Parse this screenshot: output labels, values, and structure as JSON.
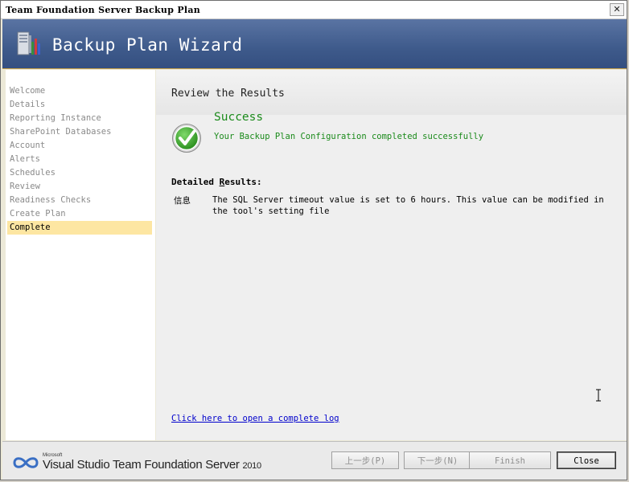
{
  "window": {
    "title": "Team Foundation Server Backup Plan",
    "close_glyph": "✕"
  },
  "banner": {
    "title": "Backup Plan Wizard",
    "icon": "server-icon"
  },
  "nav": {
    "items": [
      {
        "label": "Welcome"
      },
      {
        "label": "Details"
      },
      {
        "label": "Reporting Instance"
      },
      {
        "label": "SharePoint Databases"
      },
      {
        "label": "Account"
      },
      {
        "label": "Alerts"
      },
      {
        "label": "Schedules"
      },
      {
        "label": "Review"
      },
      {
        "label": "Readiness Checks"
      },
      {
        "label": "Create Plan"
      },
      {
        "label": "Complete"
      }
    ],
    "active_index": 10
  },
  "main": {
    "title": "Review the Results",
    "status_title": "Success",
    "status_message": "Your Backup Plan Configuration completed successfully",
    "status_icon": "checkmark-icon",
    "details_heading_prefix": "Detailed ",
    "details_heading_mnemonic": "R",
    "details_heading_suffix": "esults:",
    "details": [
      {
        "type": "信息",
        "message": "The SQL Server timeout value is set to 6 hours. This value can be modified in the tool's setting file"
      }
    ],
    "log_link": "Click here to open a complete log"
  },
  "footer": {
    "brand_ms": "Microsoft",
    "brand": "Visual Studio Team Foundation Server",
    "brand_year": "2010",
    "buttons": {
      "previous": "上一步(P)",
      "next": "下一步(N)",
      "finish": "Finish",
      "close": "Close"
    }
  },
  "colors": {
    "banner": "#3e5a8b",
    "active_nav": "#fde6a2",
    "success": "#1a8a1a",
    "link": "#0000cc"
  }
}
